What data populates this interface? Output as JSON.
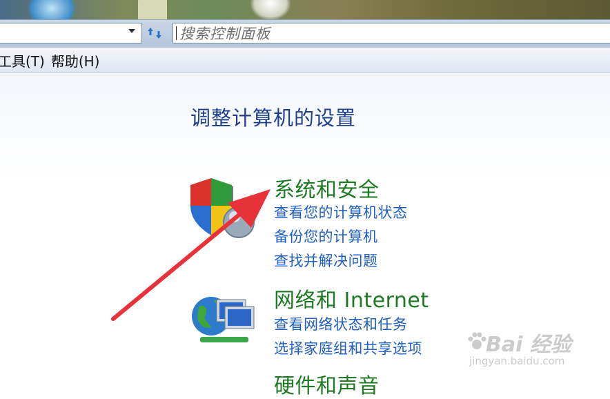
{
  "address_bar": {
    "search_placeholder": "搜索控制面板"
  },
  "menu": {
    "items": [
      "工具(T)",
      "帮助(H)"
    ]
  },
  "main": {
    "page_title": "调整计算机的设置",
    "categories": [
      {
        "title": "系统和安全",
        "icon": "shield-icon",
        "links": [
          "查看您的计算机状态",
          "备份您的计算机",
          "查找并解决问题"
        ]
      },
      {
        "title": "网络和 Internet",
        "icon": "network-icon",
        "links": [
          "查看网络状态和任务",
          "选择家庭组和共享选项"
        ]
      },
      {
        "title": "硬件和声音",
        "icon": "hardware-icon",
        "links": []
      }
    ]
  },
  "watermark": {
    "main": "Bai 经验",
    "sub": "jingyan.baidu.com"
  },
  "colors": {
    "category_title": "#1d7a23",
    "task_link": "#1f5fbf",
    "page_title": "#1e3f8a",
    "annotation_arrow": "#e8323a"
  }
}
